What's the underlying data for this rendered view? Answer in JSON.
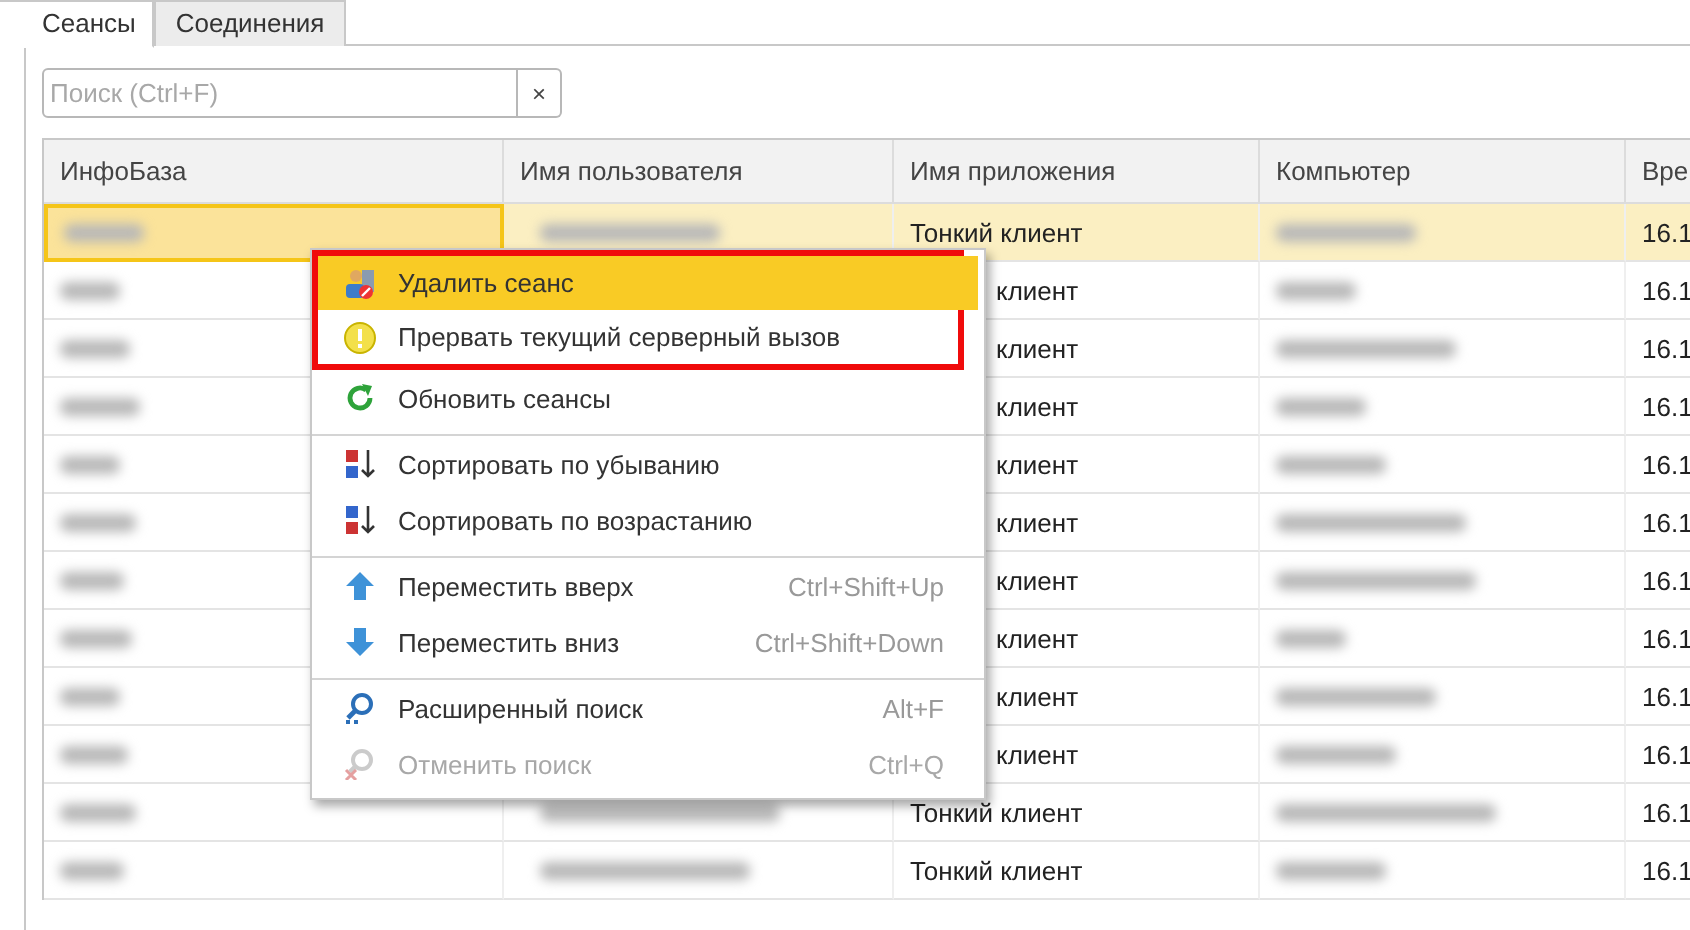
{
  "tabs": [
    {
      "label": "Сеансы",
      "selected": true
    },
    {
      "label": "Соединения",
      "selected": false
    }
  ],
  "search": {
    "placeholder": "Поиск (Ctrl+F)",
    "clear": "×"
  },
  "table": {
    "columns": [
      "ИнфоБаза",
      "Имя пользователя",
      "Имя приложения",
      "Компьютер",
      "Вре"
    ],
    "rows": [
      {
        "selected": true,
        "application": "Тонкий клиент",
        "time": "16.1"
      },
      {
        "selected": false,
        "application": "клиент",
        "time": "16.1"
      },
      {
        "selected": false,
        "application": "клиент",
        "time": "16.1"
      },
      {
        "selected": false,
        "application": "клиент",
        "time": "16.1"
      },
      {
        "selected": false,
        "application": "клиент",
        "time": "16.1"
      },
      {
        "selected": false,
        "application": "клиент",
        "time": "16.1"
      },
      {
        "selected": false,
        "application": "клиент",
        "time": "16.1"
      },
      {
        "selected": false,
        "application": "клиент",
        "time": "16.1"
      },
      {
        "selected": false,
        "application": "клиент",
        "time": "16.1"
      },
      {
        "selected": false,
        "application": "клиент",
        "time": "16.1"
      },
      {
        "selected": false,
        "application": "Тонкий клиент",
        "time": "16.1"
      },
      {
        "selected": false,
        "application": "Тонкий клиент",
        "time": "16.1"
      }
    ]
  },
  "context_menu": {
    "items": [
      {
        "label": "Удалить сеанс",
        "selected": true,
        "outlined": true,
        "separator_above": false,
        "disabled": false
      },
      {
        "label": "Прервать текущий серверный вызов",
        "selected": false,
        "outlined": true,
        "separator_above": false,
        "disabled": false
      },
      {
        "label": "Обновить сеансы",
        "selected": false,
        "outlined": false,
        "separator_above": false,
        "disabled": false
      },
      {
        "label": "Сортировать по убыванию",
        "selected": false,
        "outlined": false,
        "separator_above": true,
        "disabled": false
      },
      {
        "label": "Сортировать по возрастанию",
        "selected": false,
        "outlined": false,
        "separator_above": false,
        "disabled": false
      },
      {
        "label": "Переместить вверх",
        "shortcut": "Ctrl+Shift+Up",
        "selected": false,
        "outlined": false,
        "separator_above": true,
        "disabled": false
      },
      {
        "label": "Переместить вниз",
        "shortcut": "Ctrl+Shift+Down",
        "selected": false,
        "outlined": false,
        "separator_above": false,
        "disabled": false
      },
      {
        "label": "Расширенный поиск",
        "shortcut": "Alt+F",
        "selected": false,
        "outlined": false,
        "separator_above": true,
        "disabled": false
      },
      {
        "label": "Отменить поиск",
        "shortcut": "Ctrl+Q",
        "selected": false,
        "outlined": false,
        "separator_above": false,
        "disabled": true
      }
    ]
  }
}
